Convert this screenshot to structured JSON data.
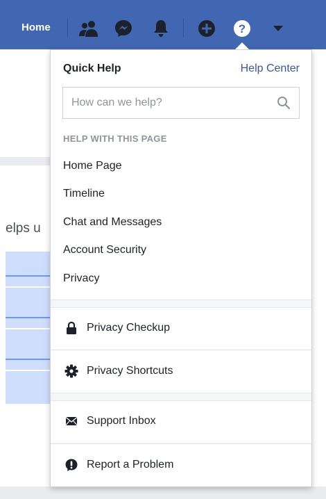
{
  "colors": {
    "brand": "#4267b2",
    "link": "#365899",
    "text": "#1d2129",
    "muted": "#90949c"
  },
  "navbar": {
    "home_label": "Home",
    "icons": [
      "friends-icon",
      "messenger-icon",
      "notifications-icon",
      "create-icon",
      "help-icon",
      "account-menu-icon"
    ]
  },
  "background": {
    "partial_text": "elps u"
  },
  "quick_help": {
    "title": "Quick Help",
    "help_center_label": "Help Center",
    "search_placeholder": "How can we help?",
    "section_label": "HELP WITH THIS PAGE",
    "page_links": [
      "Home Page",
      "Timeline",
      "Chat and Messages",
      "Account Security",
      "Privacy"
    ],
    "menu_items": [
      {
        "label": "Privacy Checkup",
        "icon": "lock-icon"
      },
      {
        "label": "Privacy Shortcuts",
        "icon": "gear-icon"
      },
      {
        "label": "Support Inbox",
        "icon": "envelope-icon"
      },
      {
        "label": "Report a Problem",
        "icon": "alert-bubble-icon"
      }
    ]
  }
}
